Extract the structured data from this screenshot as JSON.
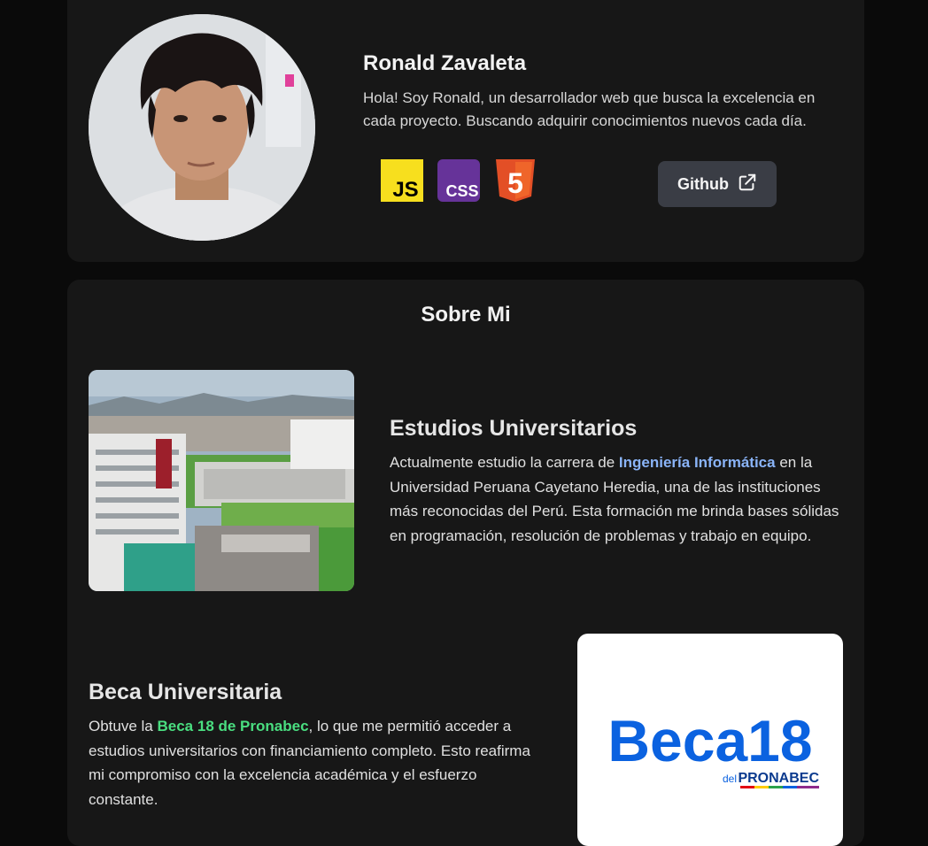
{
  "profile": {
    "name": "Ronald Zavaleta",
    "bio": "Hola! Soy Ronald, un desarrollador web que busca la excelencia en cada proyecto. Buscando adquirir conocimientos nuevos cada día.",
    "tech": [
      {
        "label": "JS",
        "icon": "javascript-icon",
        "color": "#f7df1e"
      },
      {
        "label": "CSS",
        "icon": "css-icon",
        "color": "#663399"
      },
      {
        "label": "5",
        "icon": "html5-icon",
        "color": "#e34f26"
      }
    ],
    "github_label": "Github"
  },
  "about": {
    "title": "Sobre Mi",
    "university": {
      "title": "Estudios Universitarios",
      "text_before": "Actualmente estudio la carrera de ",
      "highlight": "Ingeniería Informática",
      "text_after": " en la Universidad Peruana Cayetano Heredia, una de las instituciones más reconocidas del Perú. Esta formación me brinda bases sólidas en programación, resolución de problemas y trabajo en equipo."
    },
    "scholarship": {
      "title": "Beca Universitaria",
      "text_before": "Obtuve la ",
      "highlight": "Beca 18 de Pronabec",
      "text_after": ", lo que me permitió acceder a estudios universitarios con financiamiento completo. Esto reafirma mi compromiso con la excelencia académica y el esfuerzo constante.",
      "logo_main": "Beca18",
      "logo_prefix": "del",
      "logo_brand": "PRONABEC"
    }
  },
  "colors": {
    "page_bg": "#0a0a0a",
    "card_bg": "#171717",
    "button_bg": "#3a3d45",
    "link_blue": "#8ab4f8",
    "link_green": "#4ade80",
    "beca_blue": "#0b62e0"
  }
}
